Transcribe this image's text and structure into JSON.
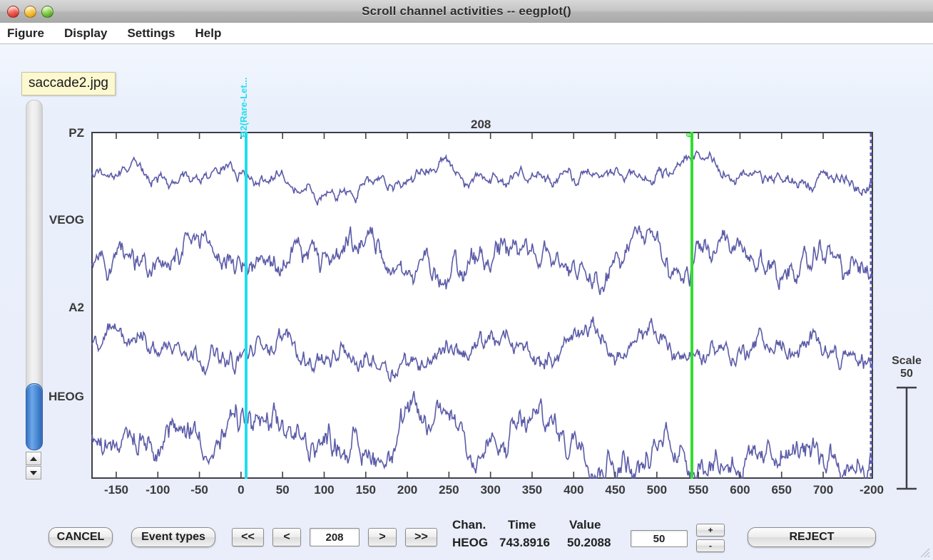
{
  "window": {
    "title": "Scroll channel activities -- eegplot()",
    "controls": [
      "close",
      "minimize",
      "zoom"
    ]
  },
  "menu": {
    "items": [
      {
        "label": "Figure"
      },
      {
        "label": "Display"
      },
      {
        "label": "Settings"
      },
      {
        "label": "Help"
      }
    ]
  },
  "tooltip": {
    "text": "saccade2.jpg"
  },
  "scrollbar": {
    "up_arrow": "▲",
    "down_arrow": "▼"
  },
  "plot": {
    "epoch_label": "208",
    "channels": [
      "PZ",
      "VEOG",
      "A2",
      "HEOG"
    ],
    "events": [
      {
        "label": "B2(Rare-Let...",
        "color": "#22ddee",
        "time": 0
      },
      {
        "label": "6",
        "color": "#33dd33",
        "time": 570
      }
    ],
    "epoch_boundary_color": "#5b5bb0",
    "trace_color": "#5b5ba8"
  },
  "scale_legend": {
    "title": "Scale",
    "value": "50"
  },
  "chart_data": {
    "type": "line",
    "title": "Scroll channel activities -- eegplot()",
    "xlabel": "",
    "ylabel": "",
    "xlim": [
      -180,
      760
    ],
    "xticks": [
      -150,
      -100,
      -50,
      0,
      50,
      100,
      150,
      200,
      250,
      300,
      350,
      400,
      450,
      500,
      550,
      600,
      650,
      700
    ],
    "xticklabels": [
      "-150",
      "-100",
      "-50",
      "0",
      "50",
      "100",
      "150",
      "200",
      "250",
      "300",
      "350",
      "400",
      "450",
      "500",
      "550",
      "600",
      "650",
      "700",
      "-200"
    ],
    "grid": false,
    "legend": "none",
    "series": [
      {
        "name": "PZ",
        "baseline": 60,
        "amplitude": 22
      },
      {
        "name": "VEOG",
        "baseline": 185,
        "amplitude": 45
      },
      {
        "name": "A2",
        "baseline": 305,
        "amplitude": 35
      },
      {
        "name": "HEOG",
        "baseline": 430,
        "amplitude": 50
      }
    ],
    "markers": [
      {
        "label": "B2(Rare-Let...",
        "x": 0,
        "color": "#22ddee"
      },
      {
        "label": "6",
        "x": 570,
        "color": "#33dd33"
      }
    ]
  },
  "bottombar": {
    "cancel_label": "CANCEL",
    "event_types_label": "Event types",
    "nav_first_label": "<<",
    "nav_prev_label": "<",
    "epoch_value": "208",
    "nav_next_label": ">",
    "nav_last_label": ">>",
    "readout": {
      "header_chan": "Chan.",
      "header_time": "Time",
      "header_value": "Value",
      "chan": "HEOG",
      "time": "743.8916",
      "value": "50.2088"
    },
    "scale_value": "50",
    "scale_up_label": "+",
    "scale_down_label": "-",
    "reject_label": "REJECT"
  }
}
